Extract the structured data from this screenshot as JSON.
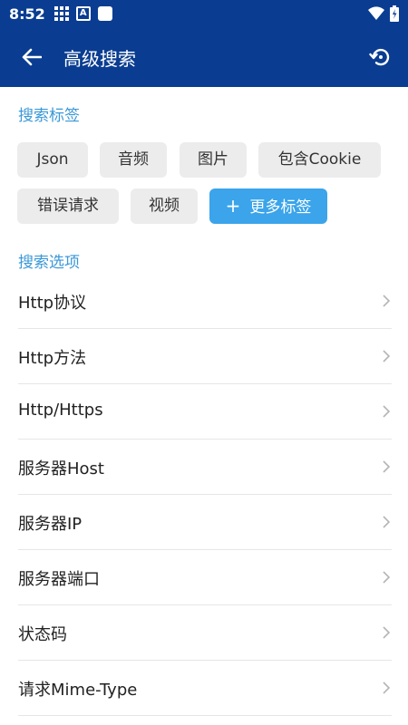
{
  "status": {
    "time": "8:52"
  },
  "toolbar": {
    "title": "高级搜索"
  },
  "sections": {
    "tags_title": "搜索标签",
    "options_title": "搜索选项"
  },
  "tags": [
    "Json",
    "音频",
    "图片",
    "包含Cookie",
    "错误请求",
    "视频"
  ],
  "more_tags": {
    "plus": "+",
    "label": "更多标签"
  },
  "options": [
    "Http协议",
    "Http方法",
    "Http/Https",
    "服务器Host",
    "服务器IP",
    "服务器端口",
    "状态码",
    "请求Mime-Type"
  ],
  "colors": {
    "primary": "#0a3d91",
    "accent": "#3ba4ea",
    "section_title": "#3a98d8",
    "tag_bg": "#ececec"
  },
  "icons": {
    "back": "arrow-left-icon",
    "history": "history-icon",
    "chevron": "chevron-right-icon"
  }
}
